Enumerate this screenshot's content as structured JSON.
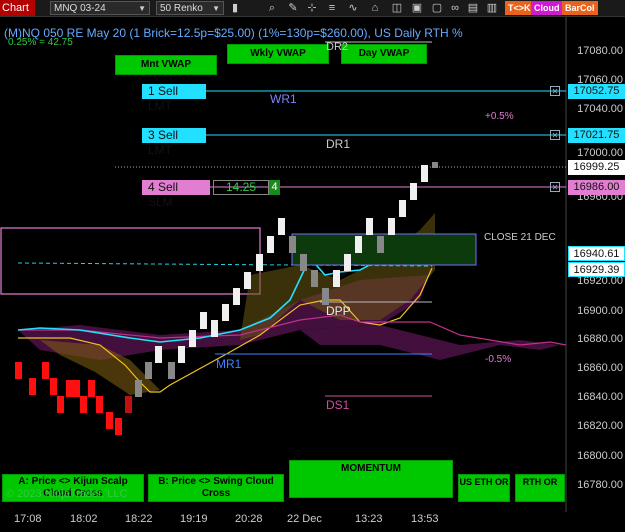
{
  "toolbar": {
    "chart_label": "Chart",
    "instrument": "MNQ 03-24",
    "bar_type": "50 Renko",
    "badges": {
      "tk": "T<>K",
      "cloud": "Cloud",
      "barcol": "BarCol"
    },
    "colors": {
      "tk": "#e8641e",
      "cloud": "#d01ad0",
      "barcol": "#e8641e",
      "chart": "#b30000"
    }
  },
  "chart": {
    "title": "(M)NQ 050 RE May 20 (1 Brick=12.5p=$25.00) (1%=130p=$260.00), US Daily RTH %",
    "subtitle": "0.25% = 42.75",
    "copyright": "© 2023 NinjaTrader, LLC",
    "vwap_buttons": {
      "mnt": "Mnt VWAP",
      "wkly": "Wkly VWAP",
      "day": "Day VWAP"
    },
    "levels": {
      "wr1": "WR1",
      "dr1": "DR1",
      "dr2": "DR2",
      "dpp": "DPP",
      "mr1": "MR1",
      "ds1": "DS1",
      "plus_half": "+0.5%",
      "minus_half": "-0.5%",
      "close_21_dec": "CLOSE 21 DEC"
    },
    "orders": [
      {
        "label": "1 Sell LMT",
        "price": "17052.75"
      },
      {
        "label": "3 Sell LMT",
        "price": "17021.75"
      },
      {
        "label": "4 Sell SLM",
        "price": "16986.00",
        "offset": "14.25",
        "qty": "4"
      }
    ],
    "price_tags": {
      "last": "16999.25",
      "cyan1": "16940.61",
      "cyan2": "16929.39"
    },
    "y_axis": [
      "17080.00",
      "17060.00",
      "17040.00",
      "17020.00",
      "17000.00",
      "16980.00",
      "16960.00",
      "16940.00",
      "16920.00",
      "16900.00",
      "16880.00",
      "16860.00",
      "16840.00",
      "16820.00",
      "16800.00",
      "16780.00"
    ],
    "x_axis": [
      "17:08",
      "18:02",
      "18:22",
      "19:19",
      "20:28",
      "22 Dec",
      "13:23",
      "13:53"
    ],
    "bottom_buttons": {
      "a": "A: Price <> Kijun Scalp Cloud Cross",
      "b": "B: Price <> Swing Cloud Cross",
      "momentum": "MOMENTUM",
      "us_eth": "US ETH OR",
      "rth": "RTH OR"
    }
  }
}
